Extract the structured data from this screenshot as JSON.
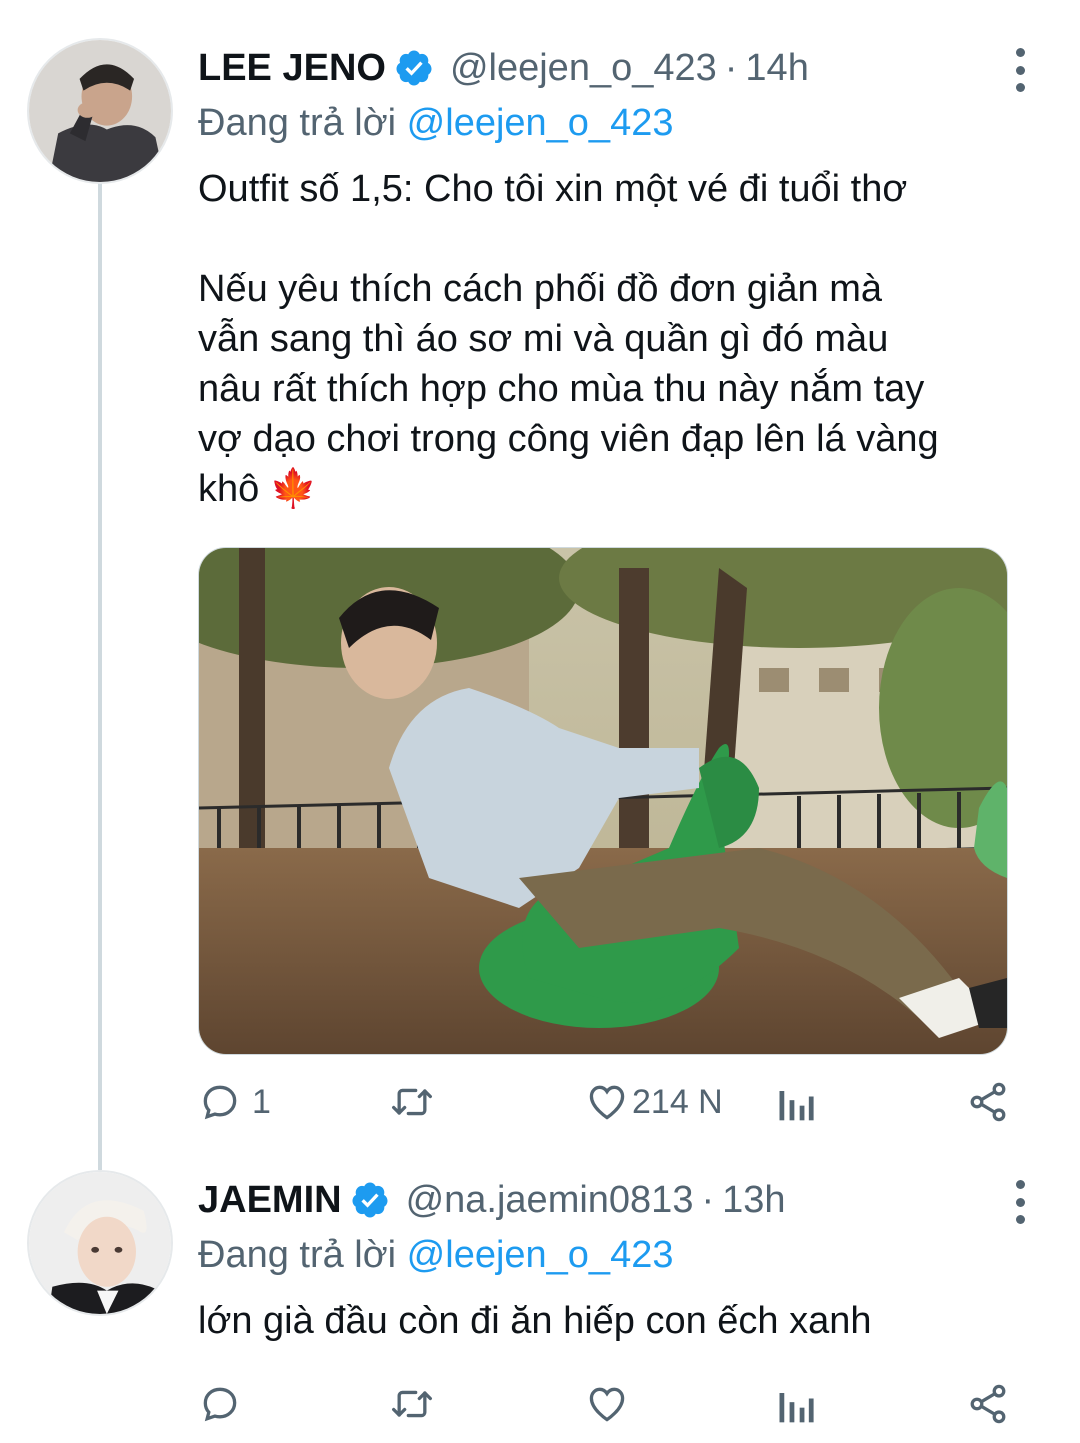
{
  "tweets": [
    {
      "name": "LEE JENO",
      "handle": "@leejen_o_423",
      "separator": "·",
      "time": "14h",
      "reply_prefix": "Đang trả lời",
      "reply_to": "@leejen_o_423",
      "text_line1": "Outfit số 1,5: Cho tôi xin một vé đi tuổi thơ",
      "text_line2": "Nếu yêu thích cách phối đồ đơn giản mà",
      "text_line3": "vẫn sang thì áo sơ mi và quần gì đó màu",
      "text_line4": "nâu rất thích hợp cho mùa thu này nắm tay",
      "text_line5": "vợ dạo chơi trong công viên đạp lên lá vàng",
      "text_line6": "khô 🍁",
      "reply_count": "1",
      "retweet_count": "",
      "like_count": "214 N"
    },
    {
      "name": "JAEMIN",
      "handle": "@na.jaemin0813",
      "separator": "·",
      "time": "13h",
      "reply_prefix": "Đang trả lời",
      "reply_to": "@leejen_o_423",
      "text_line1": "lớn già đầu còn đi ăn hiếp con ếch xanh",
      "reply_count": "",
      "retweet_count": "",
      "like_count": ""
    }
  ],
  "icons": {
    "verified": "verified-badge-icon",
    "reply": "reply-bubble-icon",
    "retweet": "retweet-icon",
    "like": "heart-icon",
    "analytics": "analytics-bars-icon",
    "share": "share-nodes-icon",
    "more": "more-vertical-icon",
    "leaf": "maple-leaf-emoji"
  },
  "colors": {
    "link": "#1d9bf0",
    "secondary": "#536471",
    "primary": "#0f1419",
    "thread_line": "#cfd9de"
  }
}
